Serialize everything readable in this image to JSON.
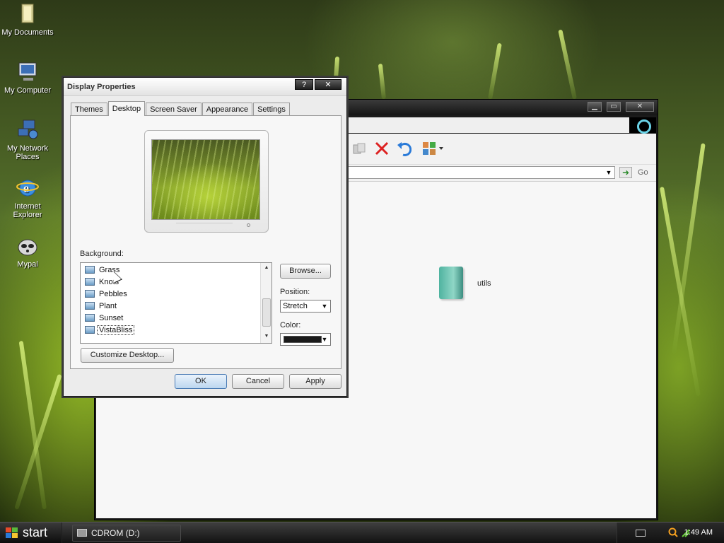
{
  "desktop": {
    "icons": [
      {
        "label": "My Documents",
        "icon": "documents-icon"
      },
      {
        "label": "My Computer",
        "icon": "computer-icon"
      },
      {
        "label": "My Network Places",
        "icon": "network-icon"
      },
      {
        "label": "Internet Explorer",
        "icon": "ie-icon"
      },
      {
        "label": "Mypal",
        "icon": "raccoon-icon"
      }
    ]
  },
  "explorer": {
    "go_label": "Go",
    "items": [
      {
        "label": "utils",
        "icon": "folder-icon"
      }
    ]
  },
  "dialog": {
    "title": "Display Properties",
    "help_glyph": "?",
    "close_glyph": "✕",
    "tabs": [
      {
        "label": "Themes"
      },
      {
        "label": "Desktop",
        "active": true
      },
      {
        "label": "Screen Saver"
      },
      {
        "label": "Appearance"
      },
      {
        "label": "Settings"
      }
    ],
    "background_label": "Background:",
    "backgrounds": [
      {
        "label": "Grass"
      },
      {
        "label": "Knots"
      },
      {
        "label": "Pebbles"
      },
      {
        "label": "Plant"
      },
      {
        "label": "Sunset"
      },
      {
        "label": "VistaBliss",
        "selected": true
      }
    ],
    "browse_label": "Browse...",
    "position_label": "Position:",
    "position_value": "Stretch",
    "color_label": "Color:",
    "color_value": "#1a1a1a",
    "customize_label": "Customize Desktop...",
    "ok_label": "OK",
    "cancel_label": "Cancel",
    "apply_label": "Apply"
  },
  "taskbar": {
    "start_label": "start",
    "tasks": [
      {
        "label": "CDROM (D:)"
      }
    ],
    "clock": "1:49 AM"
  }
}
